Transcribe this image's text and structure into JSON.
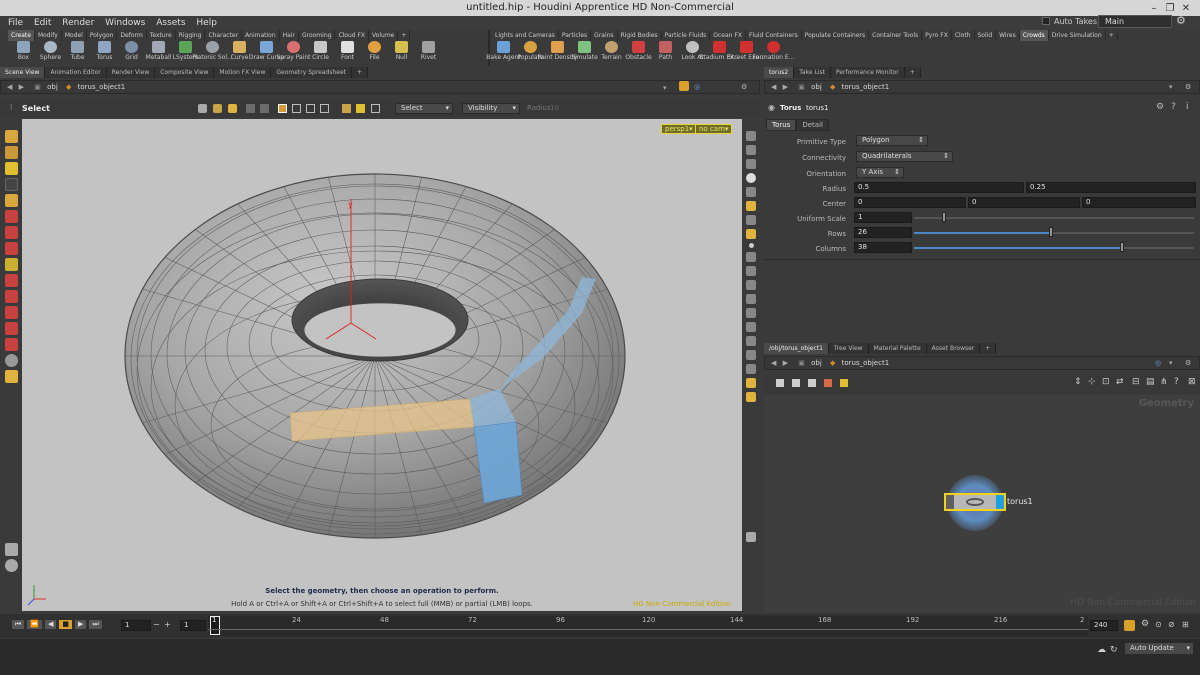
{
  "window": {
    "title": "untitled.hip - Houdini Apprentice HD Non-Commercial",
    "controls": [
      "–",
      "❐",
      "✕"
    ]
  },
  "menu": [
    "File",
    "Edit",
    "Render",
    "Windows",
    "Assets",
    "Help"
  ],
  "auto_takes_label": "Auto Takes",
  "desktop": "Main",
  "shelf_tabs_left": [
    "Create",
    "Modify",
    "Model",
    "Polygon",
    "Deform",
    "Texture",
    "Rigging",
    "Character",
    "Animation",
    "Hair",
    "Grooming",
    "Cloud FX",
    "Volume",
    "+"
  ],
  "shelf_tabs_right": [
    "Lights and Cameras",
    "Particles",
    "Grains",
    "Rigid Bodies",
    "Particle Fluids",
    "Ocean FX",
    "Fluid Containers",
    "Populate Containers",
    "Container Tools",
    "Pyro FX",
    "Cloth",
    "Solid",
    "Wires",
    "Crowds",
    "Drive Simulation",
    "+"
  ],
  "tools_left": [
    {
      "label": "Box",
      "icon": "box-icon",
      "color": "#8ea3bd"
    },
    {
      "label": "Sphere",
      "icon": "sphere-icon",
      "color": "#a9b6c6"
    },
    {
      "label": "Tube",
      "icon": "tube-icon",
      "color": "#8fa0b5"
    },
    {
      "label": "Torus",
      "icon": "torus-icon",
      "color": "#8ea6c4"
    },
    {
      "label": "Grid",
      "icon": "grid-icon",
      "color": "#7d8fa5"
    },
    {
      "label": "Metaball",
      "icon": "metaball-icon",
      "color": "#a0a8b8"
    },
    {
      "label": "LSystem",
      "icon": "lsystem-icon",
      "color": "#5aa55a"
    },
    {
      "label": "Platonic Sol...",
      "icon": "platonic-icon",
      "color": "#9aa0aa"
    },
    {
      "label": "Curve",
      "icon": "curve-icon",
      "color": "#d7b060"
    },
    {
      "label": "Draw Curve",
      "icon": "draw-curve-icon",
      "color": "#7aa6d8"
    },
    {
      "label": "Spray Paint",
      "icon": "spray-paint-icon",
      "color": "#d97070"
    },
    {
      "label": "Circle",
      "icon": "circle-icon",
      "color": "#c8c8c8"
    },
    {
      "label": "Font",
      "icon": "font-icon",
      "color": "#e0e0e0"
    },
    {
      "label": "File",
      "icon": "file-icon",
      "color": "#e0a040"
    },
    {
      "label": "Null",
      "icon": "null-icon",
      "color": "#d8c050"
    },
    {
      "label": "Rivet",
      "icon": "rivet-icon",
      "color": "#a0a0a0"
    }
  ],
  "tools_right": [
    {
      "label": "Bake Agent",
      "icon": "bake-agent-icon",
      "color": "#6ea0d8"
    },
    {
      "label": "Populate",
      "icon": "populate-icon",
      "color": "#d8a040"
    },
    {
      "label": "Paint Density",
      "icon": "paint-density-icon",
      "color": "#e0a050"
    },
    {
      "label": "Simulate",
      "icon": "simulate-icon",
      "color": "#80c080"
    },
    {
      "label": "Terrain",
      "icon": "terrain-icon",
      "color": "#c0a070"
    },
    {
      "label": "Obstacle",
      "icon": "obstacle-icon",
      "color": "#d04040"
    },
    {
      "label": "Path",
      "icon": "path-icon",
      "color": "#c06060"
    },
    {
      "label": "Look At",
      "icon": "look-at-icon",
      "color": "#c0c0c0"
    },
    {
      "label": "Stadium Ex...",
      "icon": "stadium-example-icon",
      "color": "#d03030"
    },
    {
      "label": "Street Exa...",
      "icon": "street-example-icon",
      "color": "#d03030"
    },
    {
      "label": "Formation E...",
      "icon": "formation-example-icon",
      "color": "#d03030"
    }
  ],
  "left_pane_tabs": [
    "Scene View",
    "Animation Editor",
    "Render View",
    "Composite View",
    "Motion FX View",
    "Geometry Spreadsheet",
    "+"
  ],
  "left_path": {
    "context": "obj",
    "node": "torus_object1"
  },
  "viewer_toolbar": {
    "mode": "Select",
    "select_dropdown": "Select",
    "visibility_dropdown": "Visibility",
    "radius_label": "Radius",
    "radius_value": "10"
  },
  "viewport": {
    "camera_label": "persp1▾",
    "cam_label": "no cam▾",
    "hint_title": "Select the geometry, then choose an operation to perform.",
    "hint_sub": "Hold A or Ctrl+A or Shift+A or Ctrl+Shift+A to select full (MMB) or partial (LMB) loops.",
    "watermark": "HD Non-Commercial Edition"
  },
  "params_pane_tabs": [
    "torus2",
    "Take List",
    "Performance Monitor",
    "+"
  ],
  "params_path": {
    "context": "obj",
    "node": "torus_object1"
  },
  "node_header": {
    "type": "Torus",
    "name": "torus1"
  },
  "param_tabs": [
    "Torus",
    "Detail"
  ],
  "params": {
    "primitive_type": {
      "label": "Primitive Type",
      "value": "Polygon"
    },
    "connectivity": {
      "label": "Connectivity",
      "value": "Quadrilaterals"
    },
    "orientation": {
      "label": "Orientation",
      "value": "Y Axis"
    },
    "radius": {
      "label": "Radius",
      "v1": "0.5",
      "v2": "0.25"
    },
    "center": {
      "label": "Center",
      "v1": "0",
      "v2": "0",
      "v3": "0"
    },
    "uniform_scale": {
      "label": "Uniform Scale",
      "value": "1"
    },
    "rows": {
      "label": "Rows",
      "value": "26"
    },
    "columns": {
      "label": "Columns",
      "value": "38"
    }
  },
  "network_pane_tabs": [
    "/obj/torus_object1",
    "Tree View",
    "Material Palette",
    "Asset Browser",
    "+"
  ],
  "network_path": {
    "context": "obj",
    "node": "torus_object1"
  },
  "network": {
    "context_label": "Geometry",
    "node_label": "torus1",
    "watermark": "HD Non-Commercial Edition"
  },
  "timeline": {
    "frame": "1",
    "start": "1",
    "end": "240",
    "ticks": [
      "1",
      "24",
      "48",
      "72",
      "96",
      "120",
      "144",
      "168",
      "192",
      "216",
      "2"
    ]
  },
  "status": {
    "auto_update": "Auto Update"
  }
}
